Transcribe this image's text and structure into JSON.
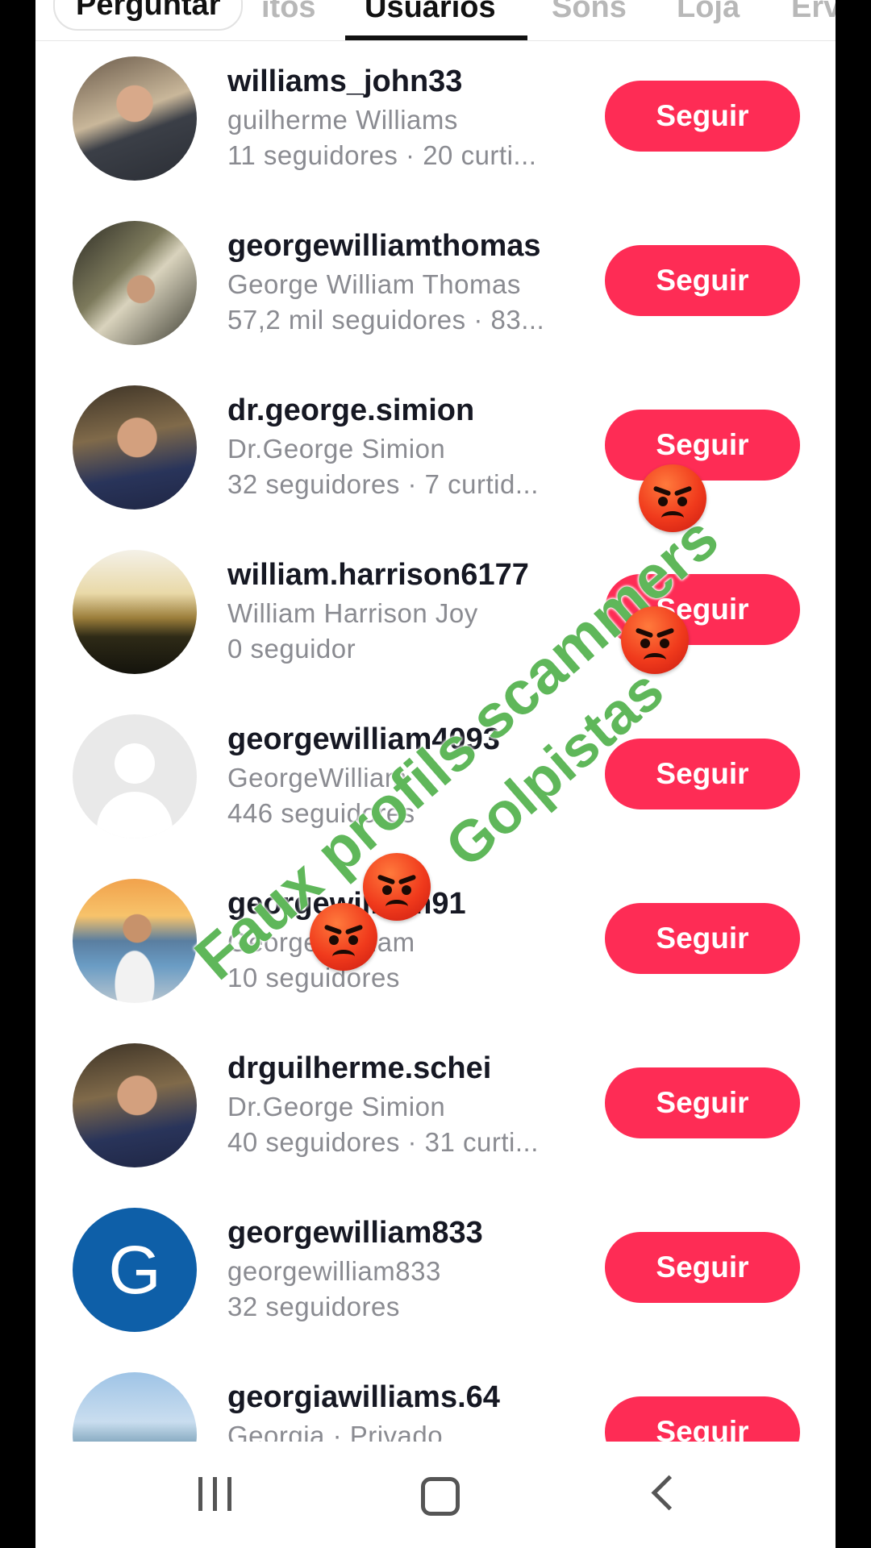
{
  "tabs": {
    "ask": "Perguntar",
    "items": [
      "ıtos",
      "Usuários",
      "Sons",
      "Loja",
      "Ervas"
    ]
  },
  "users": [
    {
      "username": "williams_john33",
      "display_name": "guilherme Williams",
      "stats": "11 seguidores · 20 curti...",
      "avatar": "photo-man-suit",
      "follow": "Seguir"
    },
    {
      "username": "georgewilliamthomas",
      "display_name": "George William Thomas",
      "stats": "57,2 mil seguidores · 83...",
      "avatar": "photo-man-selfie-room",
      "follow": "Seguir"
    },
    {
      "username": "dr.george.simion",
      "display_name": "Dr.George Simion",
      "stats": "32 seguidores · 7 curtid...",
      "avatar": "photo-man-smiling",
      "follow": "Seguir"
    },
    {
      "username": "william.harrison6177",
      "display_name": "William Harrison Joy",
      "stats": "0 seguidor",
      "avatar": "photo-sunset-field",
      "follow": "Seguir"
    },
    {
      "username": "georgewilliam4093",
      "display_name": "GeorgeWilliam",
      "stats": "446 seguidores",
      "avatar": "default-avatar",
      "follow": "Seguir"
    },
    {
      "username": "georgewilliam91",
      "display_name": "George William",
      "stats": "10 seguidores",
      "avatar": "photo-man-beach",
      "follow": "Seguir"
    },
    {
      "username": "drguilherme.schei",
      "display_name": "Dr.George Simion",
      "stats": "40 seguidores · 31 curti...",
      "avatar": "photo-man-smiling",
      "follow": "Seguir"
    },
    {
      "username": "georgewilliam833",
      "display_name": "georgewilliam833",
      "stats": "32 seguidores",
      "avatar": "letter-avatar",
      "letter": "G",
      "follow": "Seguir"
    },
    {
      "username": "georgiawilliams.64",
      "display_name": "Georgia · Privado",
      "stats": "",
      "avatar": "photo-sea",
      "follow": "Seguir"
    }
  ],
  "overlay": {
    "line1": "Faux profils scammers",
    "line2": "Golpistas"
  },
  "colors": {
    "follow_button": "#fe2c55",
    "overlay_text": "#5fb75a",
    "letter_avatar": "#0e5fa8"
  },
  "nav": {
    "recent": "recent-apps-icon",
    "home": "home-icon",
    "back": "back-icon"
  }
}
